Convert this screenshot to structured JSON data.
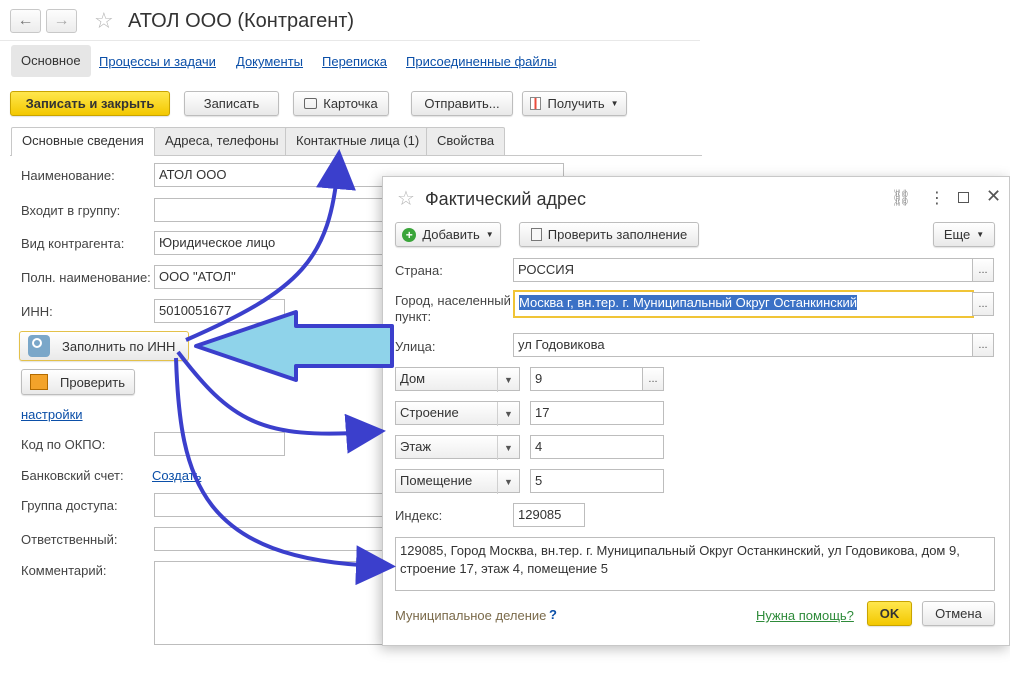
{
  "window": {
    "title": "АТОЛ ООО (Контрагент)"
  },
  "sections": [
    {
      "label": "Основное",
      "active": true
    },
    {
      "label": "Процессы и задачи"
    },
    {
      "label": "Документы"
    },
    {
      "label": "Переписка"
    },
    {
      "label": "Присоединенные файлы"
    }
  ],
  "toolbar": {
    "save_close": "Записать и закрыть",
    "save": "Записать",
    "card": "Карточка",
    "send": "Отправить...",
    "get": "Получить"
  },
  "tabs": [
    {
      "label": "Основные сведения",
      "active": true
    },
    {
      "label": "Адреса, телефоны"
    },
    {
      "label": "Контактные лица (1)"
    },
    {
      "label": "Свойства"
    }
  ],
  "form": {
    "name_label": "Наименование:",
    "name_value": "АТОЛ ООО",
    "group_label": "Входит в группу:",
    "type_label": "Вид контрагента:",
    "type_value": "Юридическое лицо",
    "full_name_label": "Полн. наименование:",
    "full_name_value": "ООО \"АТОЛ\"",
    "inn_label": "ИНН:",
    "inn_value": "5010051677",
    "fill_inn_button": "Заполнить по ИНН",
    "check_button": "Проверить",
    "settings_link": "настройки",
    "okpo_label": "Код по ОКПО:",
    "bank_label": "Банковский счет:",
    "bank_create_link": "Создать",
    "access_label": "Группа доступа:",
    "responsible_label": "Ответственный:",
    "comment_label": "Комментарий:"
  },
  "dialog": {
    "title": "Фактический адрес",
    "add_button": "Добавить",
    "check_fill_button": "Проверить заполнение",
    "more_button": "Еще",
    "country_label": "Страна:",
    "country_value": "РОССИЯ",
    "city_label_line1": "Город, населенный",
    "city_label_line2": "пункт:",
    "city_value": "Москва г, вн.тер. г. Муниципальный Округ Останкинский",
    "street_label": "Улица:",
    "street_value": "ул Годовикова",
    "house_type": "Дом",
    "house_value": "9",
    "building_type": "Строение",
    "building_value": "17",
    "floor_type": "Этаж",
    "floor_value": "4",
    "room_type": "Помещение",
    "room_value": "5",
    "index_label": "Индекс:",
    "index_value": "129085",
    "full_address_line1": "129085, Город Москва, вн.тер. г. Муниципальный Округ Останкинский, ул Годовикова, дом 9,",
    "full_address_line2": "строение 17, этаж 4, помещение 5",
    "municipal_label": "Муниципальное деление",
    "municipal_help": "?",
    "help_link": "Нужна помощь?",
    "ok_button": "OK",
    "cancel_button": "Отмена"
  },
  "colors": {
    "accent_yellow": "#f5cf00",
    "link_blue": "#0b4fa8",
    "arrow_blue": "#3b3fcc",
    "big_arrow_fill": "#8fd3ea",
    "help_green": "#2e8b3a"
  }
}
